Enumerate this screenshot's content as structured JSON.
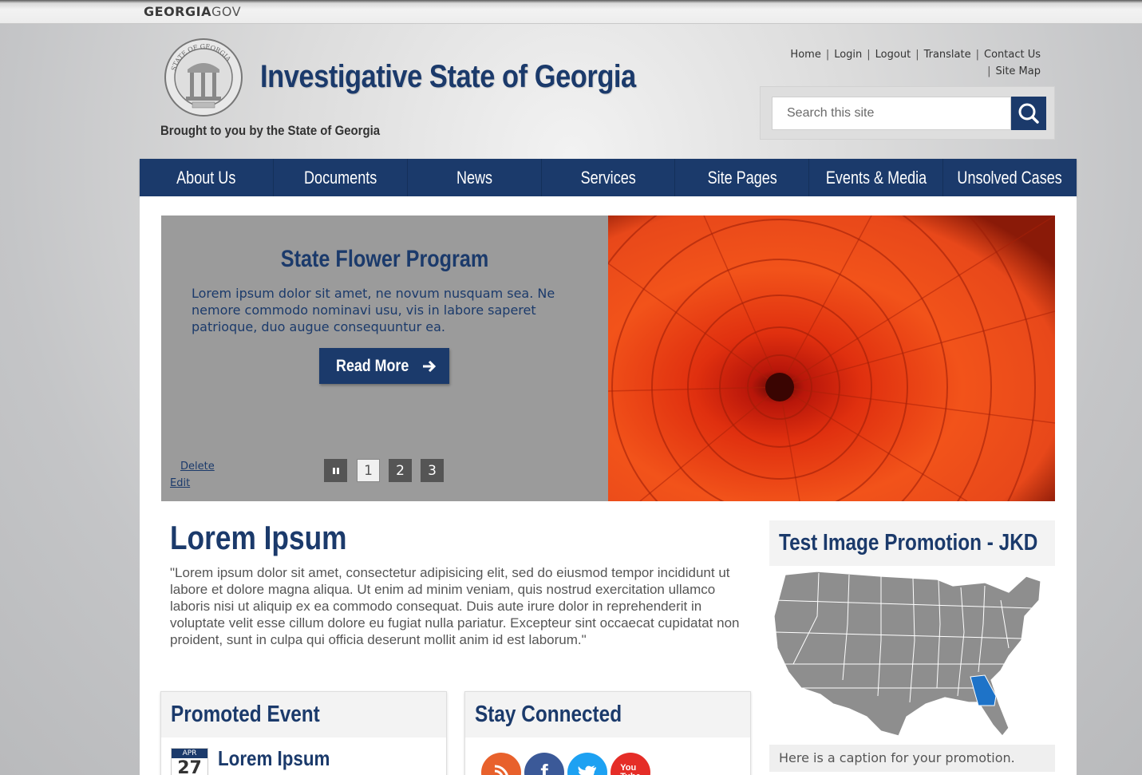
{
  "topbar": {
    "logo_bold": "GEORGIA",
    "logo_light": "GOV"
  },
  "header": {
    "title": "Investigative State of Georgia",
    "tagline": "Brought to you by the State of Georgia",
    "seal_alt": "STATE OF GEORGIA 1776"
  },
  "utility_links": {
    "home": "Home",
    "login": "Login",
    "logout": "Logout",
    "translate": "Translate",
    "contact": "Contact Us",
    "sitemap": "Site Map"
  },
  "search": {
    "placeholder": "Search this site"
  },
  "nav": {
    "items": [
      {
        "label": "About Us"
      },
      {
        "label": "Documents"
      },
      {
        "label": "News"
      },
      {
        "label": "Services"
      },
      {
        "label": "Site Pages"
      },
      {
        "label": "Events & Media"
      },
      {
        "label": "Unsolved Cases"
      }
    ]
  },
  "slider": {
    "title": "State Flower Program",
    "text": "Lorem ipsum dolor sit amet, ne novum nusquam sea. Ne nemore commodo nominavi usu, vis in labore saperet patrioque, duo augue consequuntur ea.",
    "read_more": "Read More",
    "delete_link": "Delete",
    "edit_link": "Edit",
    "pages": [
      "1",
      "2",
      "3"
    ],
    "active_page": "1"
  },
  "main": {
    "heading": "Lorem Ipsum",
    "text": "\"Lorem ipsum dolor sit amet, consectetur adipisicing elit, sed do eiusmod tempor incididunt ut labore et dolore magna aliqua. Ut enim ad minim veniam, quis nostrud exercitation ullamco laboris nisi ut aliquip ex ea commodo consequat. Duis aute irure dolor in reprehenderit in voluptate velit esse cillum dolore eu fugiat nulla pariatur. Excepteur sint occaecat cupidatat non proident, sunt in culpa qui officia deserunt mollit anim id est laborum.\""
  },
  "promoted_event": {
    "heading": "Promoted Event",
    "month": "APR",
    "day": "27",
    "title": "Lorem Ipsum"
  },
  "stay_connected": {
    "heading": "Stay Connected",
    "icons": [
      "rss-icon",
      "facebook-icon",
      "twitter-icon",
      "youtube-icon"
    ]
  },
  "promotion": {
    "heading": "Test Image Promotion - JKD",
    "caption": "Here is a caption for your promotion."
  },
  "colors": {
    "brand_navy": "#1b3a6b",
    "highlight_state": "#1e73c8",
    "map_gray": "#8e8e8e"
  }
}
